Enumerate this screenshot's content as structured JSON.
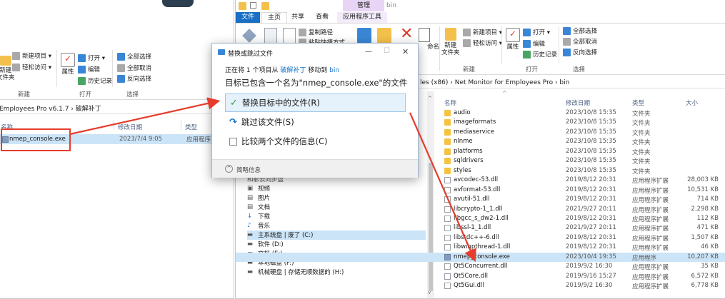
{
  "left_window": {
    "ribbon": {
      "new_item": "新建项目 ▾",
      "easy_access": "轻松访问 ▾",
      "new_folder": "新建\n文件夹",
      "open": "打开 ▾",
      "edit": "编辑",
      "history": "历史记录",
      "properties": "属性",
      "select_all": "全部选择",
      "select_none": "全部取消",
      "invert_selection": "反向选择",
      "group_new": "新建",
      "group_open": "打开",
      "group_select": "选择"
    },
    "breadcrumb": "Employees Pro v6.1.7  ›  破解补丁",
    "columns": {
      "name": "名称",
      "modified": "修改日期",
      "type": "类型"
    },
    "file": {
      "name": "nmep_console.exe",
      "date": "2023/7/4 9:05",
      "type": "应用程序"
    }
  },
  "right_window": {
    "qat_title": "bin",
    "manage_tab": "管理",
    "tabs": [
      "文件",
      "主页",
      "共享",
      "查看",
      "应用程序工具"
    ],
    "ribbon": {
      "copy_path": "复制路径",
      "paste_shortcut": "粘贴快捷方式",
      "rename": "命名",
      "new_item": "新建项目 ▾",
      "easy_access": "轻松访问 ▾",
      "new_folder": "新建\n文件夹",
      "open": "打开 ▾",
      "edit": "编辑",
      "history": "历史记录",
      "properties": "属性",
      "select_all": "全部选择",
      "select_none": "全部取消",
      "invert_selection": "反向选择",
      "group_new": "新建",
      "group_open": "打开",
      "group_select": "选择"
    },
    "breadcrumb": "les (x86)  ›  Net Monitor for Employees Pro  ›  bin",
    "columns": {
      "name": "名称",
      "modified": "修改日期",
      "type": "类型",
      "size": "大小"
    },
    "nav": [
      {
        "label": "视频",
        "icon": "video-icon"
      },
      {
        "label": "图片",
        "icon": "picture-icon"
      },
      {
        "label": "文档",
        "icon": "document-icon"
      },
      {
        "label": "下载",
        "icon": "download-icon"
      },
      {
        "label": "音乐",
        "icon": "music-icon"
      },
      {
        "label": "主系统盘 | 废了 (C:)",
        "icon": "drive-icon"
      },
      {
        "label": "软件 (D:)",
        "icon": "drive-icon"
      },
      {
        "label": "文档 (E:)",
        "icon": "drive-icon"
      },
      {
        "label": "本地磁盘 (F:)",
        "icon": "drive-icon"
      },
      {
        "label": "机械硬盘 | 存储无顺数据的 (H:)",
        "icon": "drive-icon"
      }
    ],
    "nav_partial_top": "和影云同步盘",
    "files": [
      {
        "name": "audio",
        "date": "2023/10/8 15:35",
        "type": "文件夹",
        "size": "",
        "kind": "folder"
      },
      {
        "name": "imageformats",
        "date": "2023/10/8 15:35",
        "type": "文件夹",
        "size": "",
        "kind": "folder"
      },
      {
        "name": "mediaservice",
        "date": "2023/10/8 15:35",
        "type": "文件夹",
        "size": "",
        "kind": "folder"
      },
      {
        "name": "nlnme",
        "date": "2023/10/8 15:35",
        "type": "文件夹",
        "size": "",
        "kind": "folder"
      },
      {
        "name": "platforms",
        "date": "2023/10/8 15:35",
        "type": "文件夹",
        "size": "",
        "kind": "folder"
      },
      {
        "name": "sqldrivers",
        "date": "2023/10/8 15:35",
        "type": "文件夹",
        "size": "",
        "kind": "folder"
      },
      {
        "name": "styles",
        "date": "2023/10/8 15:35",
        "type": "文件夹",
        "size": "",
        "kind": "folder"
      },
      {
        "name": "avcodec-53.dll",
        "date": "2019/8/12 20:31",
        "type": "应用程序扩展",
        "size": "28,003 KB",
        "kind": "dll"
      },
      {
        "name": "avformat-53.dll",
        "date": "2019/8/12 20:31",
        "type": "应用程序扩展",
        "size": "10,531 KB",
        "kind": "dll"
      },
      {
        "name": "avutil-51.dll",
        "date": "2019/8/12 20:31",
        "type": "应用程序扩展",
        "size": "714 KB",
        "kind": "dll"
      },
      {
        "name": "libcrypto-1_1.dll",
        "date": "2021/9/27 20:11",
        "type": "应用程序扩展",
        "size": "2,298 KB",
        "kind": "dll"
      },
      {
        "name": "libgcc_s_dw2-1.dll",
        "date": "2019/8/12 20:31",
        "type": "应用程序扩展",
        "size": "112 KB",
        "kind": "dll"
      },
      {
        "name": "libssl-1_1.dll",
        "date": "2021/9/27 20:11",
        "type": "应用程序扩展",
        "size": "471 KB",
        "kind": "dll"
      },
      {
        "name": "libstdc++-6.dll",
        "date": "2019/8/12 20:31",
        "type": "应用程序扩展",
        "size": "1,507 KB",
        "kind": "dll"
      },
      {
        "name": "libwinpthread-1.dll",
        "date": "2019/8/12 20:31",
        "type": "应用程序扩展",
        "size": "46 KB",
        "kind": "dll"
      },
      {
        "name": "nmep_console.exe",
        "date": "2023/10/4 19:35",
        "type": "应用程序",
        "size": "10,207 KB",
        "kind": "exe"
      },
      {
        "name": "Qt5Concurrent.dll",
        "date": "2019/9/2 16:30",
        "type": "应用程序扩展",
        "size": "35 KB",
        "kind": "dll"
      },
      {
        "name": "Qt5Core.dll",
        "date": "2019/9/16 15:27",
        "type": "应用程序扩展",
        "size": "6,572 KB",
        "kind": "dll"
      },
      {
        "name": "Qt5Gui.dll",
        "date": "2019/9/2 16:30",
        "type": "应用程序扩展",
        "size": "6,778 KB",
        "kind": "dll"
      }
    ]
  },
  "dialog": {
    "title": "替换或跳过文件",
    "subtitle_prefix": "正在将 1 个项目从",
    "subtitle_from": "破解补丁",
    "subtitle_mid": "移动到",
    "subtitle_to": "bin",
    "message": "目标已包含一个名为\"nmep_console.exe\"的文件",
    "option_replace": "替换目标中的文件(R)",
    "option_skip": "跳过该文件(S)",
    "option_compare": "比较两个文件的信息(C)",
    "details": "简略信息",
    "minimize": "—",
    "maximize": "☐",
    "close": "✕"
  },
  "colors": {
    "accent": "#1a73c9",
    "selection": "#cce4f7",
    "annotation": "#e53c2c",
    "manage_tab": "#e8d5f5",
    "file_tab": "#1a6fc4"
  }
}
